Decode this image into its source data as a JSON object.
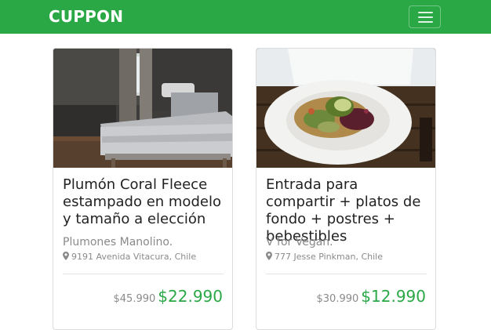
{
  "brand": "CUPPON",
  "colors": {
    "navbar": "#2aa846",
    "price": "#2aa846",
    "muted": "#8a8a8a"
  },
  "cards": [
    {
      "image": "bed-photo",
      "title": "Plumón Coral Fleece estampado en modelo y tamaño a elección",
      "seller": "Plumones Manolino.",
      "address": "9191 Avenida Vitacura, Chile",
      "old_price": "$45.990",
      "new_price": "$22.990"
    },
    {
      "image": "salad-bowl-photo",
      "title": "Entrada para compartir + platos de fondo + postres + bebestibles",
      "seller": "V for Vegan.",
      "address": "777 Jesse Pinkman, Chile",
      "old_price": "$30.990",
      "new_price": "$12.990"
    }
  ]
}
